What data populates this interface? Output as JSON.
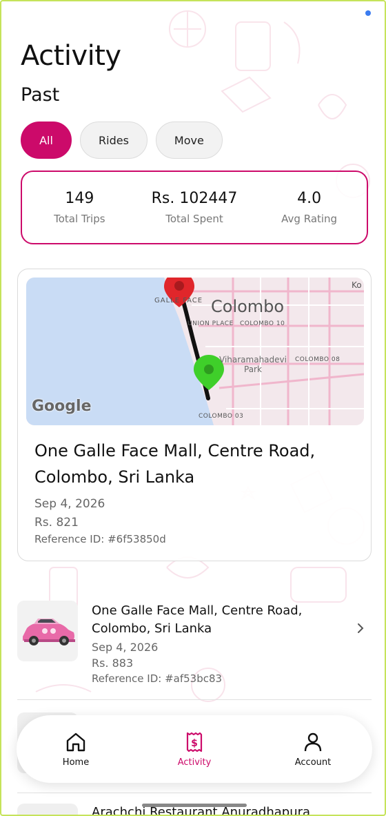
{
  "header": {
    "title": "Activity",
    "section": "Past"
  },
  "filters": [
    {
      "label": "All",
      "active": true
    },
    {
      "label": "Rides",
      "active": false
    },
    {
      "label": "Move",
      "active": false
    }
  ],
  "stats": [
    {
      "value": "149",
      "label": "Total Trips"
    },
    {
      "value": "Rs. 102447",
      "label": "Total Spent"
    },
    {
      "value": "4.0",
      "label": "Avg Rating"
    }
  ],
  "featured_trip": {
    "map": {
      "city_label": "Colombo",
      "labels": [
        "GALLE FACE",
        "UNION PLACE",
        "COLOMBO 10",
        "Viharamahadevi",
        "Park",
        "COLOMBO 08",
        "COLOMBO 03",
        "Ko"
      ],
      "logo": "Google"
    },
    "title": "One Galle Face Mall, Centre Road, Colombo, Sri Lanka",
    "date": "Sep 4, 2026",
    "price": "Rs. 821",
    "reference": "Reference ID: #6f53850d"
  },
  "trips": [
    {
      "title": "One Galle Face Mall, Centre Road, Colombo, Sri Lanka",
      "date": "Sep 4, 2026",
      "price": "Rs. 883",
      "reference": "Reference ID: #af53bc83",
      "icon": "car-icon"
    },
    {
      "title": "Arachchi Restaurant Anuradhapura"
    }
  ],
  "tabbar": {
    "items": [
      {
        "label": "Home",
        "icon": "home-icon",
        "active": false
      },
      {
        "label": "Activity",
        "icon": "receipt-icon",
        "active": true
      },
      {
        "label": "Account",
        "icon": "user-icon",
        "active": false
      }
    ]
  },
  "colors": {
    "accent": "#cc0a6a",
    "route": "#111111",
    "start_pin": "#e0262b",
    "end_pin": "#3fcf2a"
  }
}
